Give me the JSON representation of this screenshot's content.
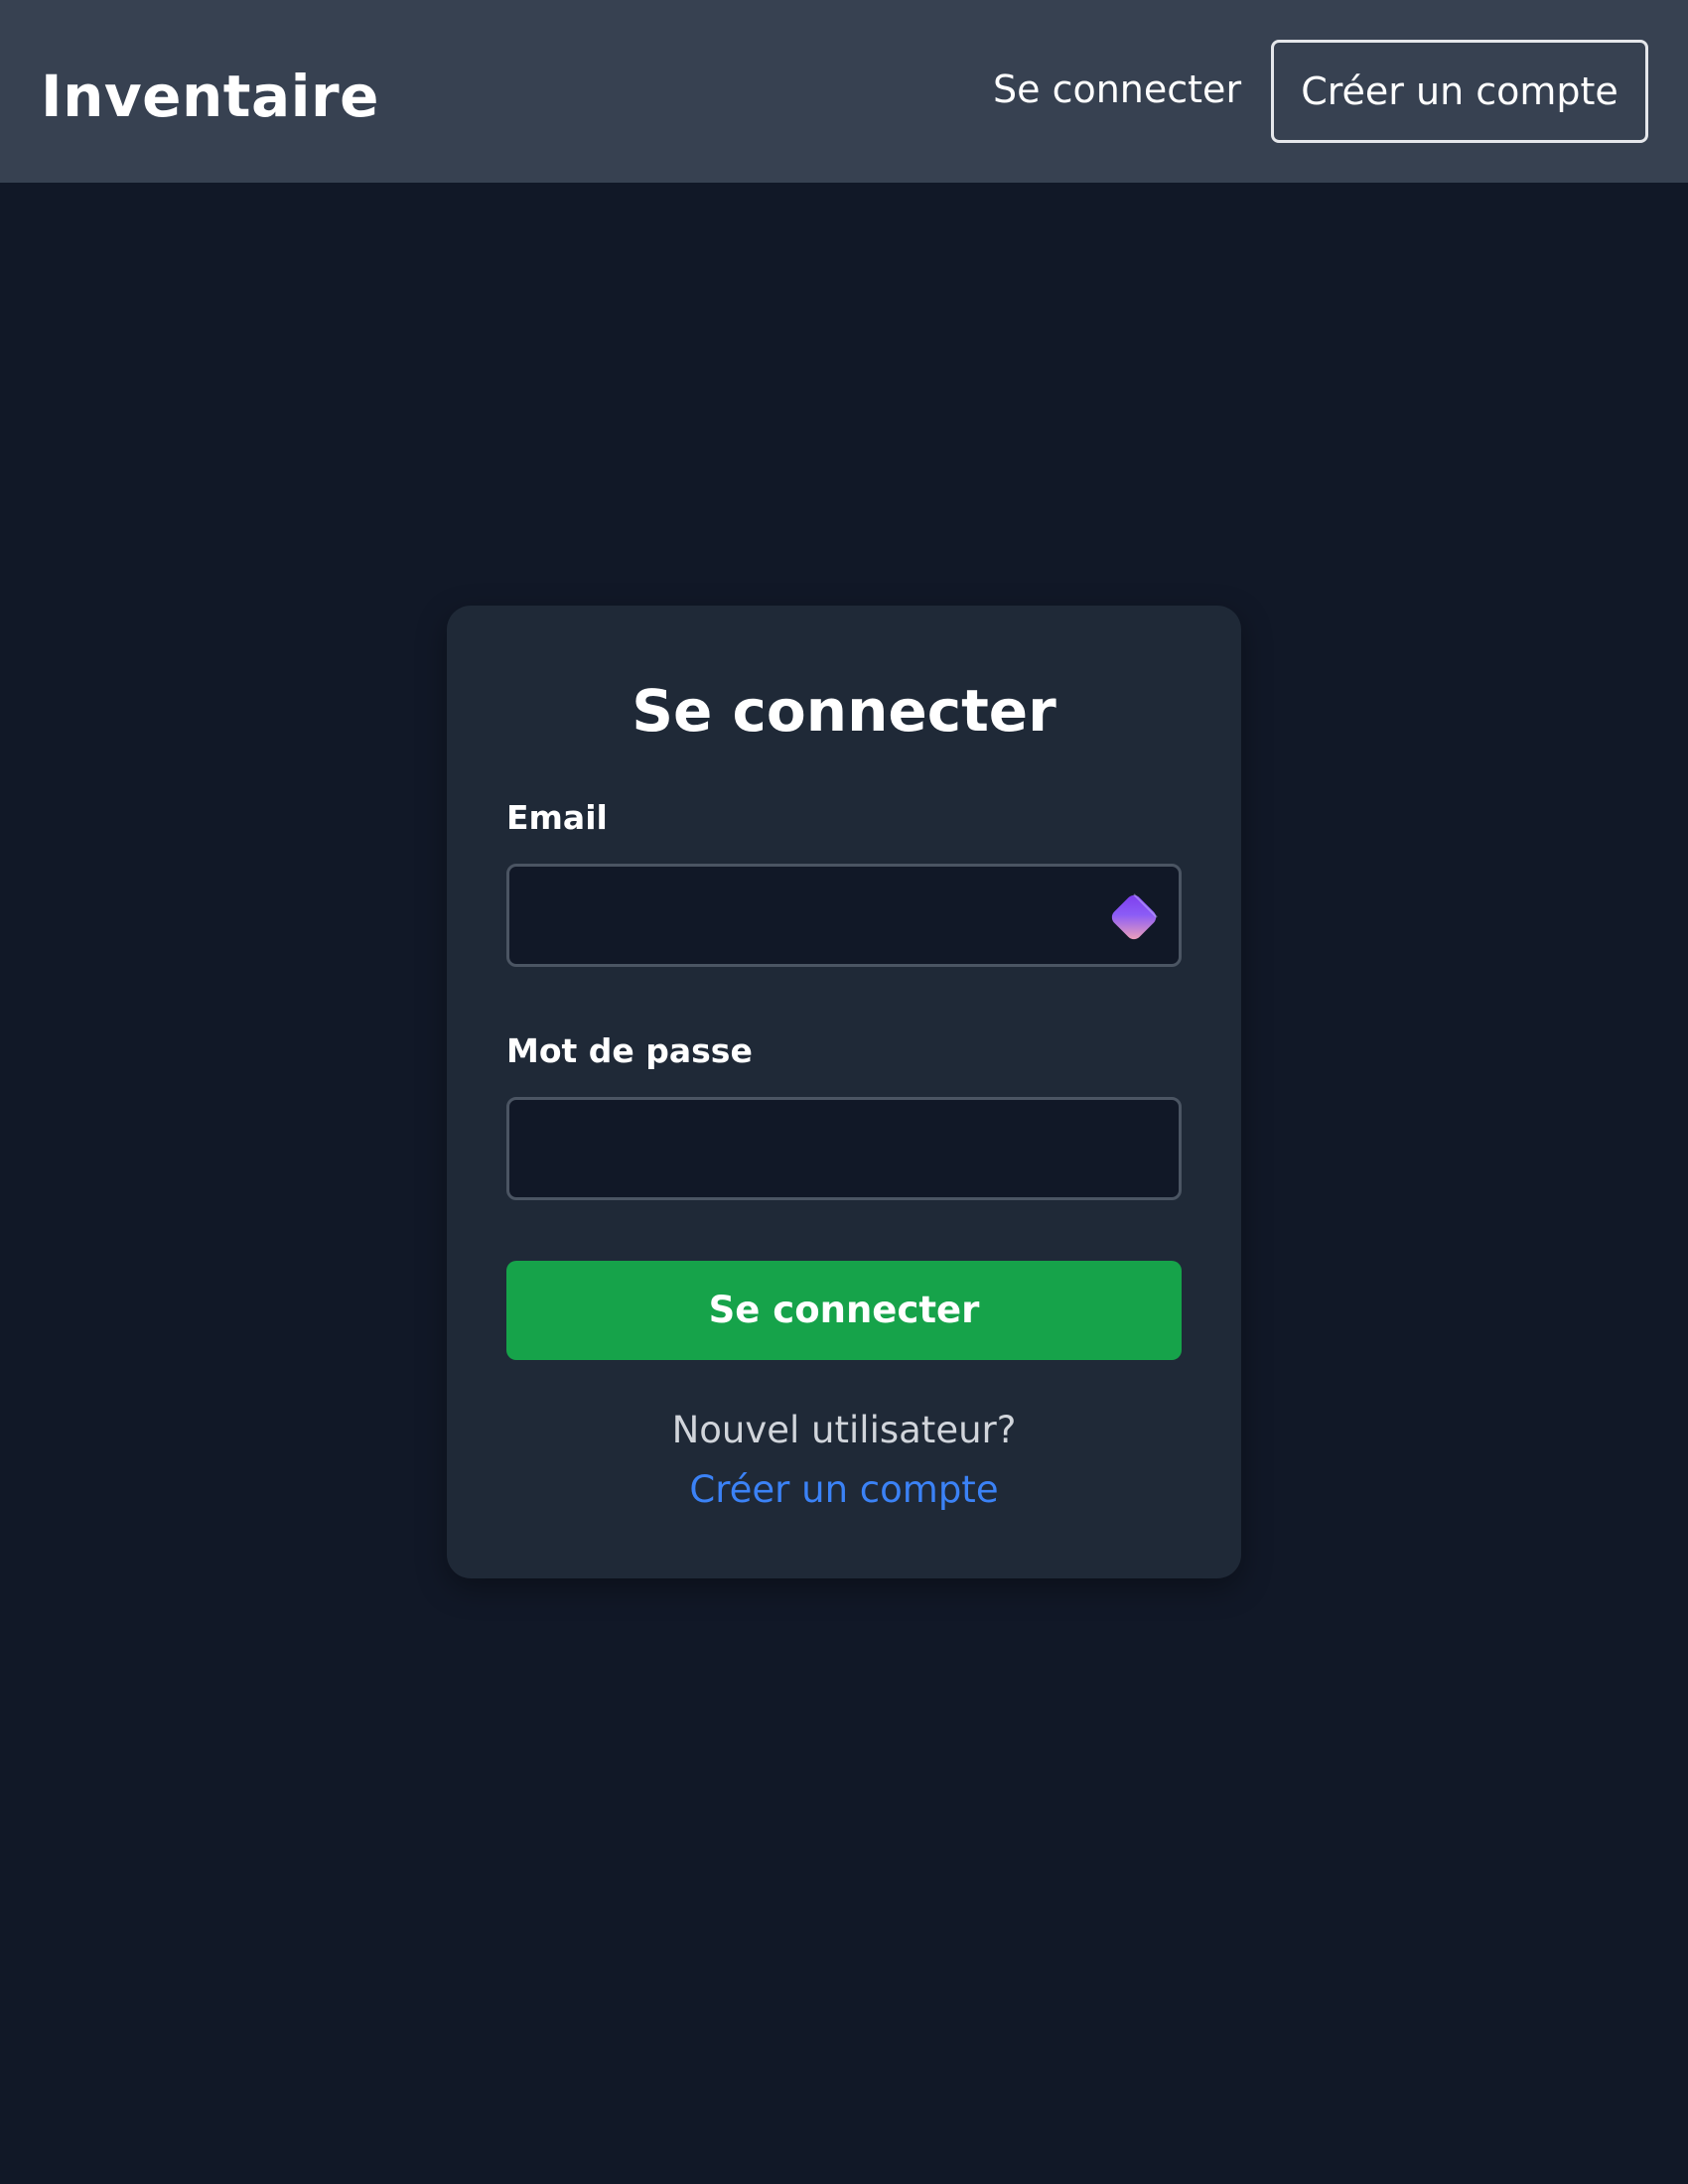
{
  "header": {
    "brand": "Inventaire",
    "login_link": "Se connecter",
    "register_button": "Créer un compte"
  },
  "login_card": {
    "title": "Se connecter",
    "email_label": "Email",
    "email_value": "",
    "password_label": "Mot de passe",
    "password_value": "",
    "submit_label": "Se connecter",
    "new_user_text": "Nouvel utilisateur?",
    "register_link": "Créer un compte",
    "email_field_icon": "password-manager-extension-icon"
  },
  "colors": {
    "page_background": "#111827",
    "header_background": "#374151",
    "card_background": "#1f2937",
    "input_background": "#111827",
    "input_border": "#4b5563",
    "primary_button": "#16a34a",
    "link": "#3b82f6",
    "muted_text": "#d1d5db"
  }
}
